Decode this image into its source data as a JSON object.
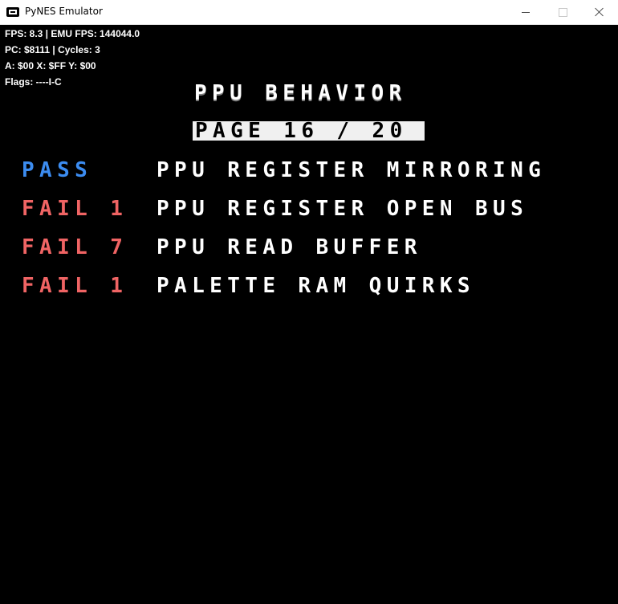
{
  "window": {
    "title": "PyNES Emulator"
  },
  "debug": {
    "fps_line": "FPS: 8.3 | EMU FPS: 144044.0",
    "pc_line": "PC: $8111 | Cycles: 3",
    "reg_line": "A: $00 X: $FF Y: $00",
    "flags_line": "Flags: ----I-C"
  },
  "screen": {
    "heading": "PPU BEHAVIOR",
    "page_indicator": "PAGE 16 / 20",
    "tests": [
      {
        "status": "PASS",
        "result": "pass",
        "name": "PPU REGISTER MIRRORING"
      },
      {
        "status": "FAIL 1",
        "result": "fail",
        "name": "PPU REGISTER OPEN BUS"
      },
      {
        "status": "FAIL 7",
        "result": "fail",
        "name": "PPU READ BUFFER"
      },
      {
        "status": "FAIL 1",
        "result": "fail",
        "name": "PALETTE RAM QUIRKS"
      }
    ]
  },
  "colors": {
    "pass": "#3c8cf0",
    "fail": "#f06464",
    "text": "#ffffff",
    "background": "#000000"
  },
  "icons": {
    "app": "nes-controller-icon",
    "minimize": "minimize-icon",
    "maximize": "maximize-icon",
    "close": "close-icon"
  }
}
